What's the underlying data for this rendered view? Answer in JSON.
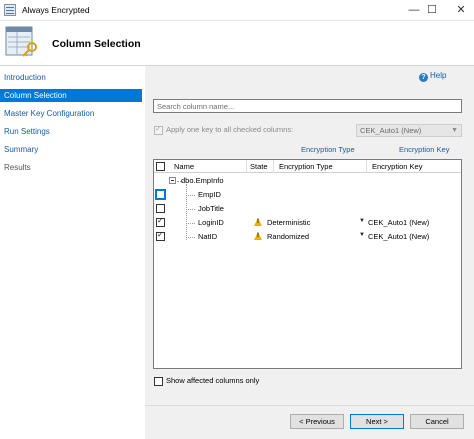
{
  "window": {
    "title": "Always Encrypted",
    "minimize": "—",
    "maximize": "☐",
    "close": "✕"
  },
  "header": {
    "title": "Column Selection",
    "icon": "wizard-key-icon"
  },
  "sidebar": {
    "items": [
      {
        "label": "Introduction",
        "state": "link"
      },
      {
        "label": "Column Selection",
        "state": "active"
      },
      {
        "label": "Master Key Configuration",
        "state": "link"
      },
      {
        "label": "Run Settings",
        "state": "link"
      },
      {
        "label": "Summary",
        "state": "link"
      },
      {
        "label": "Results",
        "state": "disabled"
      }
    ]
  },
  "help": {
    "label": "Help",
    "icon": "help-icon"
  },
  "search": {
    "placeholder": "Search column name...",
    "value": ""
  },
  "apply_key": {
    "label": "Apply one key to all checked columns:",
    "checked": true,
    "enabled": false,
    "selected_key": "CEK_Auto1 (New)"
  },
  "links": {
    "encryption_type": "Encryption Type",
    "encryption_key": "Encryption Key"
  },
  "grid": {
    "columns": [
      "Name",
      "State",
      "Encryption Type",
      "Encryption Key"
    ],
    "table_name": "dbo.EmpInfo",
    "rows": [
      {
        "name": "EmpID",
        "checked": false,
        "state": "",
        "encryption_type": "",
        "encryption_key": ""
      },
      {
        "name": "JobTitle",
        "checked": false,
        "state": "",
        "encryption_type": "",
        "encryption_key": ""
      },
      {
        "name": "LoginID",
        "checked": true,
        "state": "warning",
        "encryption_type": "Deterministic",
        "encryption_key": "CEK_Auto1 (New)"
      },
      {
        "name": "NatID",
        "checked": true,
        "state": "warning",
        "encryption_type": "Randomized",
        "encryption_key": "CEK_Auto1 (New)"
      }
    ]
  },
  "show_affected": {
    "label": "Show affected columns only",
    "checked": false
  },
  "buttons": {
    "previous": "< Previous",
    "next": "Next >",
    "cancel": "Cancel"
  },
  "colors": {
    "accent": "#0078d7",
    "link": "#1a5b9c",
    "warning": "#e8b400",
    "content_bg": "#f0f0f0"
  }
}
